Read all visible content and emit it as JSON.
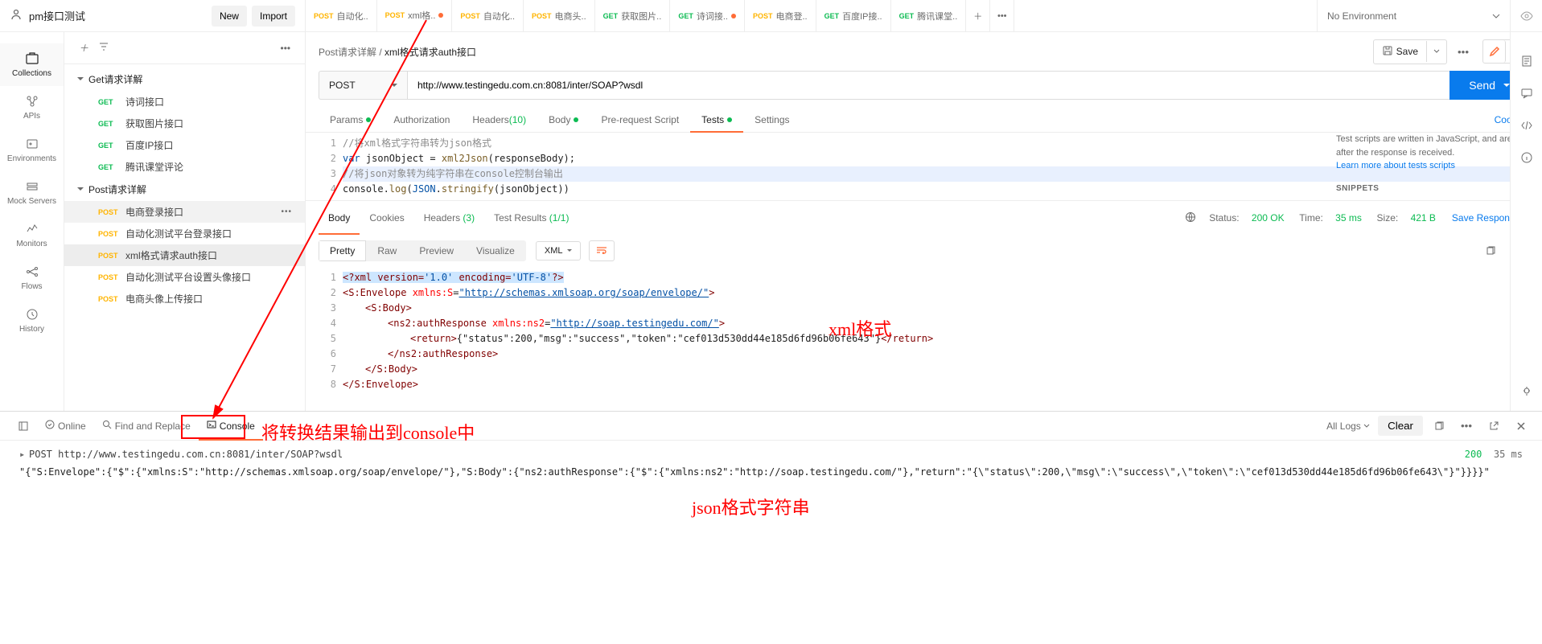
{
  "workspace": {
    "name": "pm接口测试",
    "new": "New",
    "import": "Import"
  },
  "tabs": [
    {
      "method": "POST",
      "label": "自动化..",
      "dot": false
    },
    {
      "method": "POST",
      "label": "xml格..",
      "dot": true,
      "active": true
    },
    {
      "method": "POST",
      "label": "自动化..",
      "dot": false
    },
    {
      "method": "POST",
      "label": "电商头..",
      "dot": false
    },
    {
      "method": "GET",
      "label": "获取图片..",
      "dot": false
    },
    {
      "method": "GET",
      "label": "诗词接..",
      "dot": true
    },
    {
      "method": "POST",
      "label": "电商登..",
      "dot": false
    },
    {
      "method": "GET",
      "label": "百度IP接..",
      "dot": false
    },
    {
      "method": "GET",
      "label": "腾讯课堂..",
      "dot": false
    }
  ],
  "env": {
    "label": "No Environment"
  },
  "rail": [
    {
      "label": "Collections",
      "active": true
    },
    {
      "label": "APIs"
    },
    {
      "label": "Environments"
    },
    {
      "label": "Mock Servers"
    },
    {
      "label": "Monitors"
    },
    {
      "label": "Flows"
    },
    {
      "label": "History"
    }
  ],
  "tree": {
    "folders": [
      {
        "name": "Get请求详解",
        "items": [
          {
            "m": "GET",
            "name": "诗词接口"
          },
          {
            "m": "GET",
            "name": "获取图片接口"
          },
          {
            "m": "GET",
            "name": "百度IP接口"
          },
          {
            "m": "GET",
            "name": "腾讯课堂评论"
          }
        ]
      },
      {
        "name": "Post请求详解",
        "items": [
          {
            "m": "POST",
            "name": "电商登录接口",
            "sel": true
          },
          {
            "m": "POST",
            "name": "自动化测试平台登录接口"
          },
          {
            "m": "POST",
            "name": "xml格式请求auth接口",
            "sel2": true
          },
          {
            "m": "POST",
            "name": "自动化测试平台设置头像接口"
          },
          {
            "m": "POST",
            "name": "电商头像上传接口"
          }
        ]
      }
    ]
  },
  "crumb": {
    "parent": "Post请求详解",
    "sep": " / ",
    "name": "xml格式请求auth接口",
    "save": "Save"
  },
  "request": {
    "method": "POST",
    "url": "http://www.testingedu.com.cn:8081/inter/SOAP?wsdl",
    "send": "Send"
  },
  "reqtabs": {
    "params": "Params",
    "auth": "Authorization",
    "headers": "Headers",
    "hcnt": "(10)",
    "body": "Body",
    "prereq": "Pre-request Script",
    "tests": "Tests",
    "settings": "Settings",
    "cookies": "Cookies"
  },
  "script": {
    "l1": "//将xml格式字符串转为json格式",
    "l2a": "var",
    "l2b": " jsonObject = ",
    "l2c": "xml2Json",
    "l2d": "(responseBody);",
    "l3": "//将json对象转为纯字符串在console控制台输出",
    "l4a": "console.",
    "l4b": "log",
    "l4c": "(",
    "l4d": "JSON",
    "l4e": ".",
    "l4f": "stringify",
    "l4g": "(jsonObject))"
  },
  "snip": {
    "txt": "Test scripts are written in JavaScript, and are run after the response is received.",
    "link": "Learn more about tests scripts",
    "hdr": "SNIPPETS"
  },
  "resptabs": {
    "body": "Body",
    "cookies": "Cookies",
    "headers": "Headers",
    "hcnt": "(3)",
    "results": "Test Results",
    "rcnt": "(1/1)"
  },
  "status": {
    "s": "Status:",
    "sv": "200 OK",
    "t": "Time:",
    "tv": "35 ms",
    "sz": "Size:",
    "szv": "421 B",
    "save": "Save Response"
  },
  "view": {
    "pretty": "Pretty",
    "raw": "Raw",
    "preview": "Preview",
    "visualize": "Visualize",
    "fmt": "XML"
  },
  "xml": {
    "l1a": "<?xml version=",
    "l1b": "'1.0'",
    "l1c": " encoding=",
    "l1d": "'UTF-8'",
    "l1e": "?>",
    "l2a": "<S:Envelope ",
    "l2b": "xmlns:S",
    "l2c": "=",
    "l2d": "\"http://schemas.xmlsoap.org/soap/envelope/\"",
    "l2e": ">",
    "l3": "<S:Body>",
    "l4a": "<ns2:authResponse ",
    "l4b": "xmlns:ns2",
    "l4c": "=",
    "l4d": "\"http://soap.testingedu.com/\"",
    "l4e": ">",
    "l5a": "<return>",
    "l5b": "{\"status\":200,\"msg\":\"success\",\"token\":\"cef013d530dd44e185d6fd96b06fe643\"}",
    "l5c": "</return>",
    "l6": "</ns2:authResponse>",
    "l7": "</S:Body>",
    "l8": "</S:Envelope>"
  },
  "footer": {
    "online": "Online",
    "find": "Find and Replace",
    "console": "Console",
    "logs": "All Logs",
    "clear": "Clear",
    "logline": "POST http://www.testingedu.com.cn:8081/inter/SOAP?wsdl",
    "logstatus": "200",
    "logtime": "35 ms",
    "output": "\"{\"S:Envelope\":{\"$\":{\"xmlns:S\":\"http://schemas.xmlsoap.org/soap/envelope/\"},\"S:Body\":{\"ns2:authResponse\":{\"$\":{\"xmlns:ns2\":\"http://soap.testingedu.com/\"},\"return\":\"{\\\"status\\\":200,\\\"msg\\\":\\\"success\\\",\\\"token\\\":\\\"cef013d530dd44e185d6fd96b06fe643\\\"}\"}}}}\""
  },
  "anno": {
    "a1": "xml格式",
    "a2": "将转换结果输出到console中",
    "a3": "json格式字符串"
  }
}
